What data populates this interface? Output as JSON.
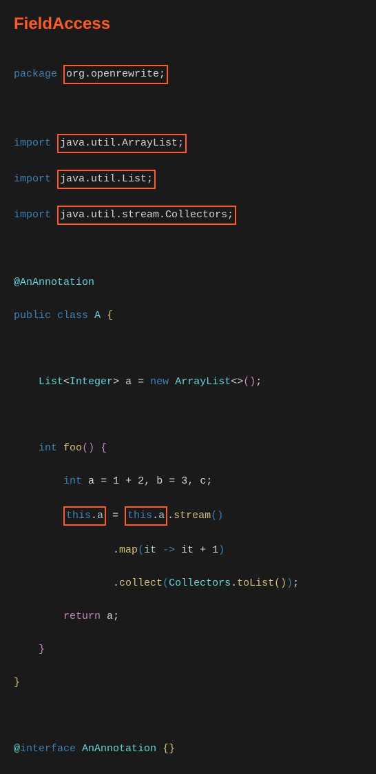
{
  "title": "FieldAccess",
  "code": {
    "package_kw": "package",
    "package_name": "org.openrewrite;",
    "import_kw": "import",
    "import1": "java.util.ArrayList;",
    "import2": "java.util.List;",
    "import3": "java.util.stream.Collectors;",
    "ann_at": "@",
    "ann_name": "AnAnnotation",
    "public_kw": "public",
    "class_kw": "class",
    "class_name": "A",
    "lbrace": "{",
    "rbrace": "}",
    "list_type": "List",
    "lt": "<",
    "gt": ">",
    "integer_type": "Integer",
    "field_a": "a",
    "eq": "=",
    "new_kw": "new",
    "arraylist_type": "ArrayList",
    "diamond": "<>",
    "paren_open": "(",
    "paren_close": ")",
    "semi": ";",
    "int_kw": "int",
    "foo_name": "foo",
    "local_decl": "int a = 1 + 2, b = 3, c;",
    "local_int": "int",
    "local_a1": "a",
    "local_eq1": "=",
    "num1": "1",
    "plus": "+",
    "num2": "2",
    "comma": ",",
    "local_b": "b",
    "local_eq2": "=",
    "num3": "3",
    "local_c": "c",
    "this_kw": "this",
    "dot": ".",
    "stream_name": "stream",
    "map_name": "map",
    "it_param": "it",
    "arrow": "->",
    "plus2": "+",
    "num1b": "1",
    "collect_name": "collect",
    "collectors_type": "Collectors",
    "tolist_name": "toList",
    "return_kw": "return",
    "interface_kw": "interface",
    "empty_braces": "{}"
  }
}
